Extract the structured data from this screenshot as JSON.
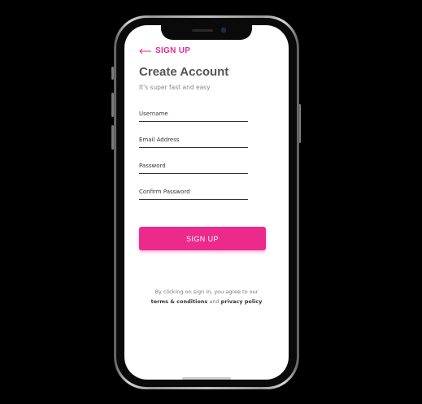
{
  "header": {
    "back_label": "SIGN UP"
  },
  "page": {
    "title": "Create Account",
    "subtitle": "It's super fast and easy"
  },
  "form": {
    "username_label": "Username",
    "email_label": "Email Address",
    "password_label": "Password",
    "confirm_password_label": "Confirm Password",
    "submit_label": "SIGN UP"
  },
  "footer": {
    "prefix": "By clicking on sign in, you agree to our",
    "terms_link": "terms & conditions",
    "joiner": "and",
    "privacy_link": "privacy policy"
  },
  "colors": {
    "accent": "#ec2a8c",
    "title": "#555555",
    "background": "#000000"
  },
  "icons": {
    "back": "arrow-left-icon"
  }
}
